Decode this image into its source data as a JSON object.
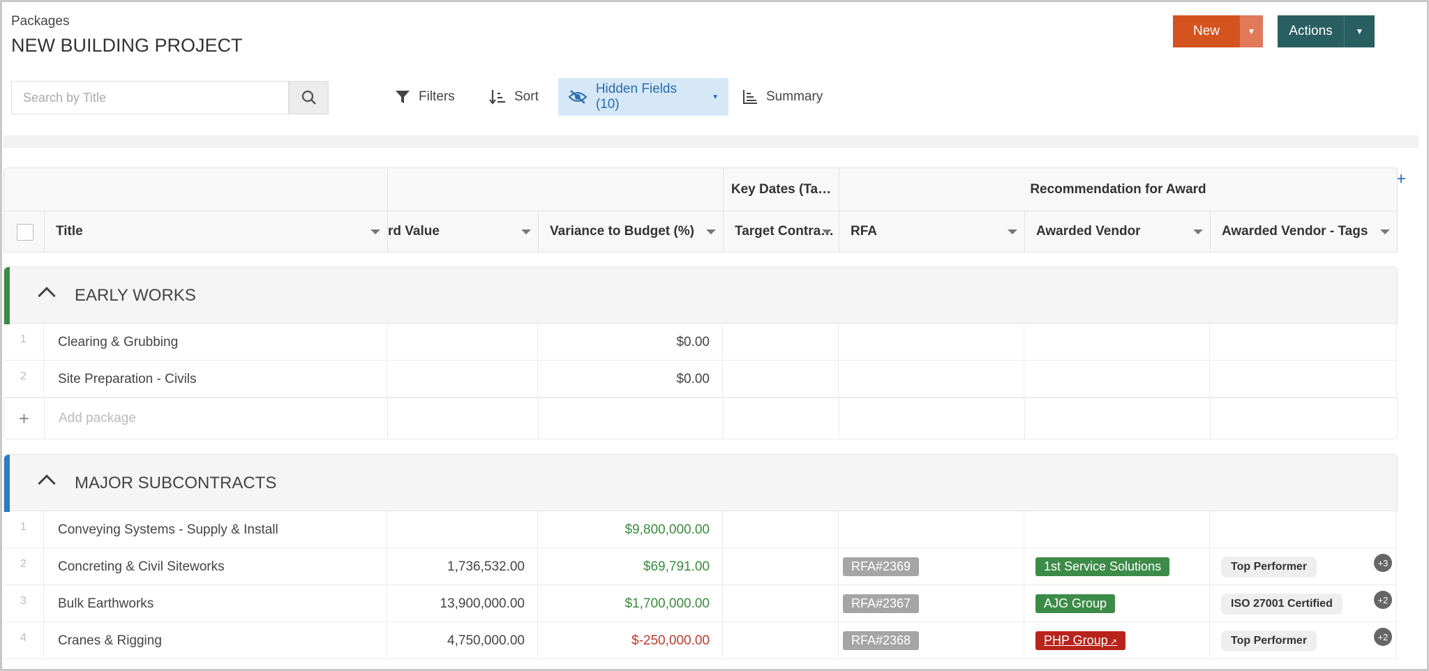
{
  "header": {
    "crumb": "Packages",
    "project": "NEW BUILDING PROJECT",
    "new_label": "New",
    "actions_label": "Actions"
  },
  "toolbar": {
    "search_placeholder": "Search by Title",
    "filters": "Filters",
    "sort": "Sort",
    "hidden_fields": "Hidden Fields (10)",
    "summary": "Summary"
  },
  "grid": {
    "groups": {
      "key_dates": "Key Dates (Ta…",
      "recommendation": "Recommendation for Award"
    },
    "columns": {
      "title": "Title",
      "award_value": "rd Value",
      "variance": "Variance to Budget (%)",
      "target": "Target Contra…",
      "rfa": "RFA",
      "vendor": "Awarded Vendor",
      "tags": "Awarded Vendor - Tags"
    },
    "sections": [
      {
        "name": "EARLY WORKS",
        "color": "#3d8b48",
        "rows": [
          {
            "n": "1",
            "title": "Clearing & Grubbing",
            "award": "",
            "variance": "$0.00"
          },
          {
            "n": "2",
            "title": "Site Preparation - Civils",
            "award": "",
            "variance": "$0.00"
          }
        ],
        "add_label": "Add package"
      },
      {
        "name": "MAJOR SUBCONTRACTS",
        "color": "#2e7cbf",
        "rows": [
          {
            "n": "1",
            "title": "Conveying Systems - Supply & Install",
            "award": "",
            "variance": "$9,800,000.00"
          },
          {
            "n": "2",
            "title": "Concreting & Civil Siteworks",
            "award": "1,736,532.00",
            "variance": "$69,791.00",
            "rfa": "RFA#2369",
            "vendor": "1st Service Solutions",
            "tag": "Top Performer",
            "more": "+3"
          },
          {
            "n": "3",
            "title": "Bulk Earthworks",
            "award": "13,900,000.00",
            "variance": "$1,700,000.00",
            "rfa": "RFA#2367",
            "vendor": "AJG Group",
            "tag": "ISO 27001 Certified",
            "more": "+2"
          },
          {
            "n": "4",
            "title": "Cranes & Rigging",
            "award": "4,750,000.00",
            "variance": "$-250,000.00",
            "rfa": "RFA#2368",
            "vendor": "PHP Group",
            "tag": "Top Performer",
            "more": "+2"
          }
        ]
      }
    ]
  }
}
